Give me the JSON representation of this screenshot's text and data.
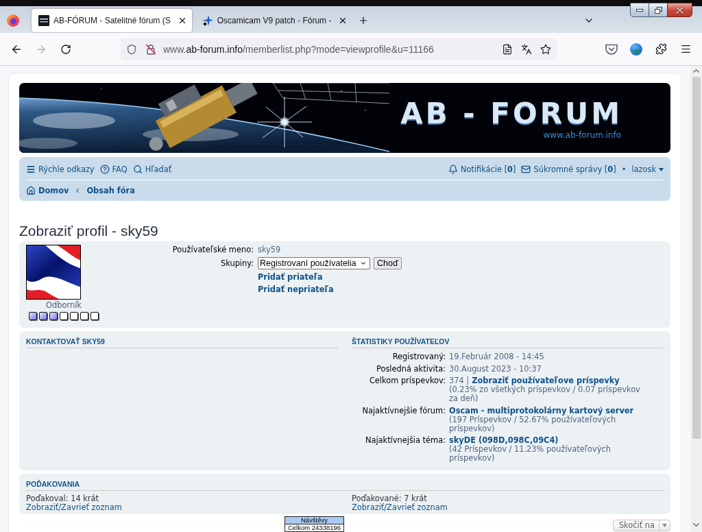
{
  "browser": {
    "tabs": [
      {
        "title": "AB-FÓRUM - Satelitné fórum (S",
        "selected": true
      },
      {
        "title": "Oscamicam V9 patch - Fórum -",
        "selected": false
      }
    ],
    "address": {
      "prefix": "www.",
      "host": "ab-forum.info",
      "path": "/memberlist.php?mode=viewprofile&u=11166"
    }
  },
  "banner": {
    "logo": "AB - FORUM",
    "url": "www.ab-forum.info"
  },
  "navbar": {
    "quick_links": [
      {
        "kind": "menu",
        "label": "Rýchle odkazy"
      },
      {
        "kind": "faq",
        "label": "FAQ"
      },
      {
        "kind": "search",
        "label": "Hľadať"
      }
    ],
    "user_links": [
      {
        "kind": "notifications",
        "label": "Notifikácie [**0**]"
      },
      {
        "kind": "messages",
        "label": "Súkromné správy [**0**]"
      }
    ],
    "separator": "•",
    "username": "lazosk",
    "breadcrumbs": [
      {
        "kind": "home",
        "label": "Domov"
      },
      {
        "kind": "forum",
        "label": "Obsah fóra"
      }
    ]
  },
  "page_title": "Zobraziť profil - sky59",
  "profile": {
    "rank": "Odborník",
    "stars": 3,
    "username": {
      "label": "Používateľské meno:",
      "value": "sky59"
    },
    "groups": {
      "label": "Skupiny:",
      "value": "Registrovaní používatelia",
      "button": "Choď"
    },
    "actions": [
      "Pridať priateľa",
      "Pridať nepriateľa"
    ]
  },
  "contact": {
    "heading": "KONTAKTOVAŤ SKY59"
  },
  "statistics": {
    "heading": "ŠTATISTIKY POUŽÍVATEĽOV",
    "rows": [
      {
        "label": "Registrovaný:",
        "value": "19.Február 2008 - 14:45"
      },
      {
        "label": "Posledná aktivita:",
        "value": "30.August 2023 - 10:37"
      },
      {
        "label": "Celkom príspevkov:",
        "value": "374 |",
        "link": "Zobraziť používateľove príspevky",
        "note": "(0.23% zo všetkých príspevkov / 0.07 príspevkov za deň)"
      },
      {
        "label": "Najaktívnejšie fórum:",
        "link": "Oscam - multiprotokolárny kartový server",
        "note": "(197 Príspevkov / 52.67% používateľových príspevkov)"
      },
      {
        "label": "Najaktívnejšia téma:",
        "link": "skyDE (098D,098C,09C4)",
        "note": "(42 Príspevkov / 11.23% používateľových príspevkov)"
      }
    ]
  },
  "thanks": {
    "heading": "POĎAKOVANIA",
    "columns": [
      {
        "text": "Poďakoval: 14 krát",
        "link": "Zobraziť/Zavrieť zoznam"
      },
      {
        "text": "Poďakované: 7 krát",
        "link": "Zobraziť/Zavrieť zoznam"
      }
    ]
  },
  "footer": {
    "counter": {
      "title": "Návštěvy",
      "total": "Celkom 24338196"
    },
    "jump_to": "Skočiť na"
  }
}
